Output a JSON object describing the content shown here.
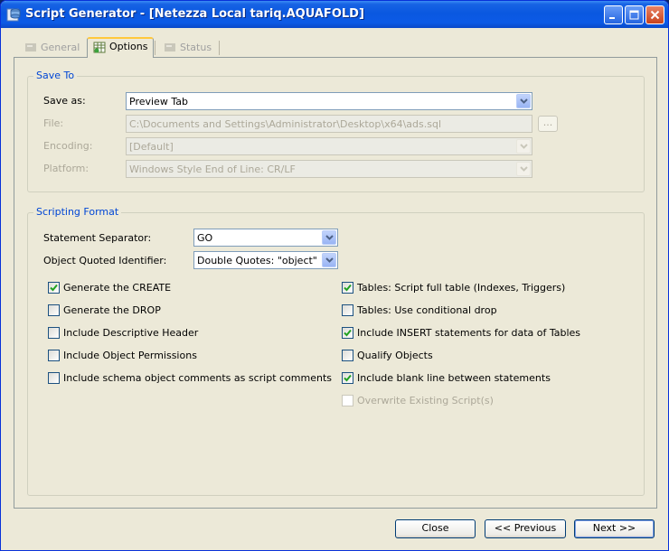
{
  "window": {
    "title": "Script Generator - [Netezza Local tariq.AQUAFOLD]"
  },
  "tabs": [
    {
      "label": "General",
      "active": false,
      "enabled": false
    },
    {
      "label": "Options",
      "active": true,
      "enabled": true
    },
    {
      "label": "Status",
      "active": false,
      "enabled": false
    }
  ],
  "save_to": {
    "title": "Save To",
    "save_as_label": "Save as:",
    "save_as_value": "Preview Tab",
    "file_label": "File:",
    "file_value": "C:\\Documents and Settings\\Administrator\\Desktop\\x64\\ads.sql",
    "browse_label": "...",
    "encoding_label": "Encoding:",
    "encoding_value": "[Default]",
    "platform_label": "Platform:",
    "platform_value": "Windows Style End of Line: CR/LF"
  },
  "scripting_format": {
    "title": "Scripting Format",
    "separator_label": "Statement Separator:",
    "separator_value": "GO",
    "quoted_label": "Object Quoted Identifier:",
    "quoted_value": "Double Quotes: \"object\"",
    "left_options": [
      {
        "label": "Generate the CREATE",
        "checked": true,
        "enabled": true
      },
      {
        "label": "Generate the DROP",
        "checked": false,
        "enabled": true
      },
      {
        "label": "Include Descriptive Header",
        "checked": false,
        "enabled": true
      },
      {
        "label": "Include Object Permissions",
        "checked": false,
        "enabled": true
      },
      {
        "label": "Include schema object comments as script comments",
        "checked": false,
        "enabled": true
      }
    ],
    "right_options": [
      {
        "label": "Tables: Script full table (Indexes, Triggers)",
        "checked": true,
        "enabled": true
      },
      {
        "label": "Tables: Use conditional drop",
        "checked": false,
        "enabled": true
      },
      {
        "label": "Include INSERT statements for data of Tables",
        "checked": true,
        "enabled": true
      },
      {
        "label": "Qualify Objects",
        "checked": false,
        "enabled": true
      },
      {
        "label": "Include blank line between statements",
        "checked": true,
        "enabled": true
      },
      {
        "label": "Overwrite Existing Script(s)",
        "checked": false,
        "enabled": false
      }
    ]
  },
  "buttons": {
    "close": "Close",
    "previous": "<< Previous",
    "next": "Next >>"
  },
  "colors": {
    "titlebar": "#0a58e0",
    "group_title": "#0046d5",
    "check": "#21a121",
    "disabled_text": "#aca899"
  }
}
